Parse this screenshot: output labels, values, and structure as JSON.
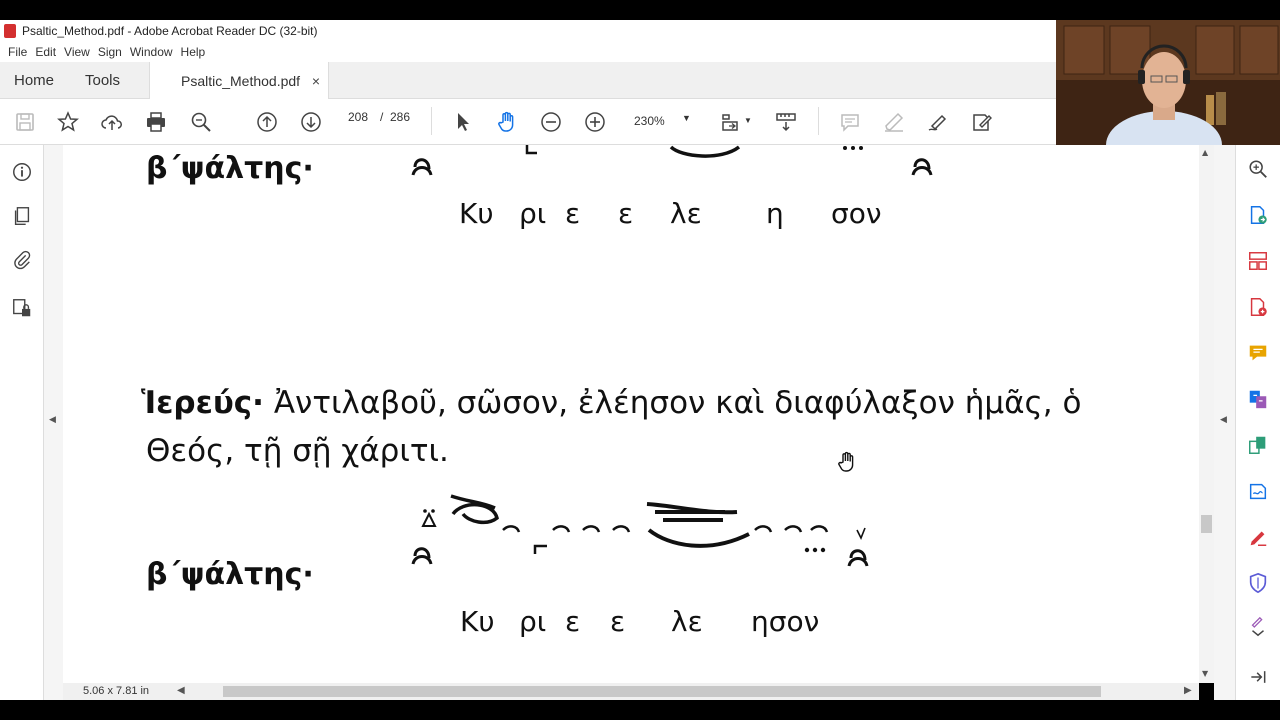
{
  "window": {
    "title": "Psaltic_Method.pdf - Adobe Acrobat Reader DC (32-bit)"
  },
  "menu": [
    "File",
    "Edit",
    "View",
    "Sign",
    "Window",
    "Help"
  ],
  "tabs": {
    "home": "Home",
    "tools": "Tools",
    "document": "Psaltic_Method.pdf",
    "close": "×"
  },
  "toolbar": {
    "current_page": "208",
    "page_separator": "/",
    "total_pages": "286",
    "zoom": "230%"
  },
  "document": {
    "block1": {
      "speaker": "β΄ψάλτης·",
      "syllables": [
        "Κυ",
        "ρι",
        "ε",
        "ε",
        "λε",
        "η",
        "σον"
      ]
    },
    "priest": {
      "speaker": "Ἱερεύς·",
      "line1": "Ἀντιλαβοῦ, σῶσον, ἐλέησον καὶ διαφύλαξον ἡμᾶς, ὁ",
      "line2": "Θεός, τῇ σῇ χάριτι."
    },
    "block2": {
      "speaker": "β΄ψάλτης·",
      "syllables": [
        "Κυ",
        "ρι",
        "ε",
        "ε",
        "λε",
        "ησον"
      ]
    }
  },
  "status": {
    "page_size": "5.06 x 7.81 in"
  },
  "colors": {
    "accent_blue": "#1473e6",
    "right_tools": [
      "#1473e6",
      "#d7373f",
      "#e8a400",
      "#2d9d78",
      "#9b59b6"
    ]
  }
}
